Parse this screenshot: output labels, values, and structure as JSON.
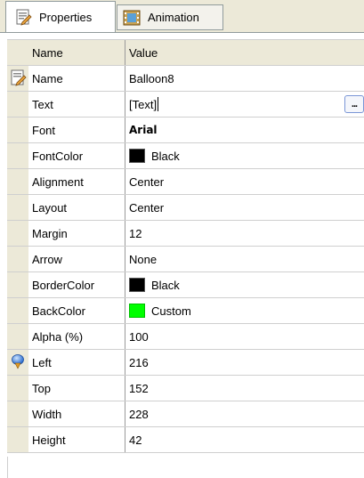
{
  "tabs": [
    {
      "label": "Properties",
      "icon": "properties-icon",
      "active": true
    },
    {
      "label": "Animation",
      "icon": "film-icon",
      "active": false
    }
  ],
  "grid": {
    "header": {
      "name": "Name",
      "value": "Value"
    },
    "rows": [
      {
        "name": "Name",
        "value": "Balloon8",
        "gutter_icon": "properties-icon"
      },
      {
        "name": "Text",
        "value": "[Text]",
        "editing": true,
        "button": "..."
      },
      {
        "name": "Font",
        "value": "Arial",
        "bold": true
      },
      {
        "name": "FontColor",
        "value": "Black",
        "swatch": "#000000"
      },
      {
        "name": "Alignment",
        "value": "Center"
      },
      {
        "name": "Layout",
        "value": "Center"
      },
      {
        "name": "Margin",
        "value": "12"
      },
      {
        "name": "Arrow",
        "value": "None"
      },
      {
        "name": "BorderColor",
        "value": "Black",
        "swatch": "#000000"
      },
      {
        "name": "BackColor",
        "value": "Custom",
        "swatch": "#00ff00"
      },
      {
        "name": "Alpha (%)",
        "value": "100"
      },
      {
        "name": "Left",
        "value": "216",
        "gutter_icon": "position-icon"
      },
      {
        "name": "Top",
        "value": "152"
      },
      {
        "name": "Width",
        "value": "228"
      },
      {
        "name": "Height",
        "value": "42"
      }
    ]
  }
}
